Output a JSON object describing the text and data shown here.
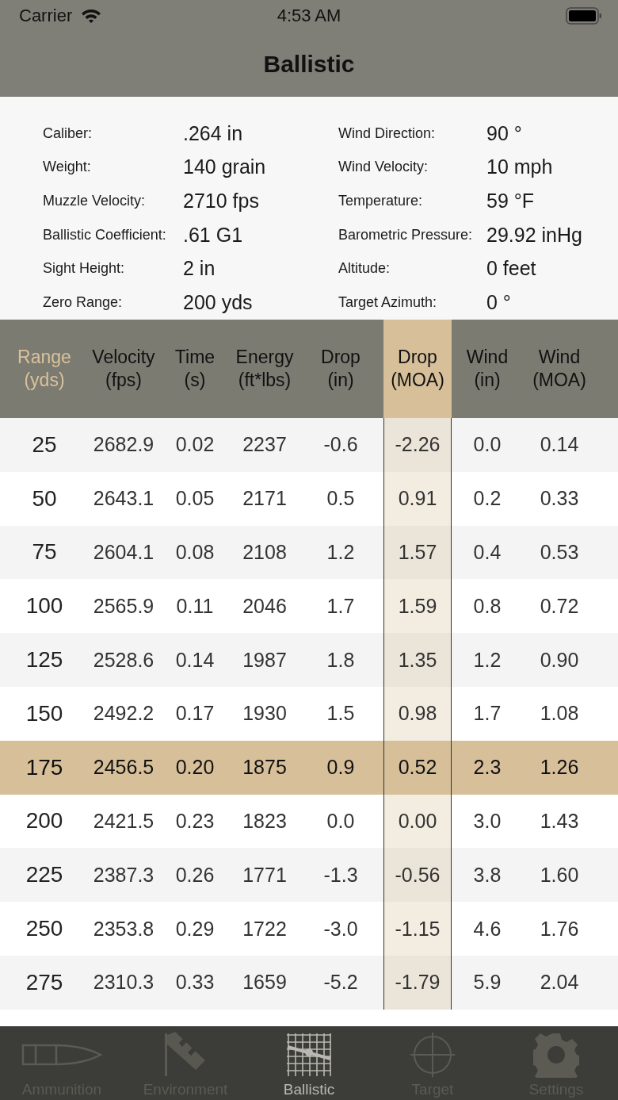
{
  "status_bar": {
    "carrier": "Carrier",
    "time": "4:53 AM"
  },
  "nav": {
    "title": "Ballistic"
  },
  "parameters": [
    {
      "label": "Caliber:",
      "value": ".264 in"
    },
    {
      "label": "Wind Direction:",
      "value": "90 °"
    },
    {
      "label": "Weight:",
      "value": "140 grain"
    },
    {
      "label": "Wind Velocity:",
      "value": "10 mph"
    },
    {
      "label": "Muzzle Velocity:",
      "value": "2710 fps"
    },
    {
      "label": "Temperature:",
      "value": "59 °F"
    },
    {
      "label": "Ballistic Coefficient:",
      "value": ".61 G1"
    },
    {
      "label": "Barometric Pressure:",
      "value": "29.92 inHg"
    },
    {
      "label": "Sight Height:",
      "value": "2 in"
    },
    {
      "label": "Altitude:",
      "value": "0 feet"
    },
    {
      "label": "Zero Range:",
      "value": "200 yds"
    },
    {
      "label": "Target Azimuth:",
      "value": "0 °"
    }
  ],
  "table": {
    "columns": [
      {
        "title": "Range",
        "unit": "(yds)",
        "active": true,
        "highlighted": false
      },
      {
        "title": "Velocity",
        "unit": "(fps)",
        "active": false,
        "highlighted": false
      },
      {
        "title": "Time",
        "unit": "(s)",
        "active": false,
        "highlighted": false
      },
      {
        "title": "Energy",
        "unit": "(ft*lbs)",
        "active": false,
        "highlighted": false
      },
      {
        "title": "Drop",
        "unit": "(in)",
        "active": false,
        "highlighted": false
      },
      {
        "title": "Drop",
        "unit": "(MOA)",
        "active": false,
        "highlighted": true
      },
      {
        "title": "Wind",
        "unit": "(in)",
        "active": false,
        "highlighted": false
      },
      {
        "title": "Wind",
        "unit": "(MOA)",
        "active": false,
        "highlighted": false
      }
    ],
    "rows": [
      {
        "selected": false,
        "cells": [
          "25",
          "2682.9",
          "0.02",
          "2237",
          "-0.6",
          "-2.26",
          "0.0",
          "0.14"
        ]
      },
      {
        "selected": false,
        "cells": [
          "50",
          "2643.1",
          "0.05",
          "2171",
          "0.5",
          "0.91",
          "0.2",
          "0.33"
        ]
      },
      {
        "selected": false,
        "cells": [
          "75",
          "2604.1",
          "0.08",
          "2108",
          "1.2",
          "1.57",
          "0.4",
          "0.53"
        ]
      },
      {
        "selected": false,
        "cells": [
          "100",
          "2565.9",
          "0.11",
          "2046",
          "1.7",
          "1.59",
          "0.8",
          "0.72"
        ]
      },
      {
        "selected": false,
        "cells": [
          "125",
          "2528.6",
          "0.14",
          "1987",
          "1.8",
          "1.35",
          "1.2",
          "0.90"
        ]
      },
      {
        "selected": false,
        "cells": [
          "150",
          "2492.2",
          "0.17",
          "1930",
          "1.5",
          "0.98",
          "1.7",
          "1.08"
        ]
      },
      {
        "selected": true,
        "cells": [
          "175",
          "2456.5",
          "0.20",
          "1875",
          "0.9",
          "0.52",
          "2.3",
          "1.26"
        ]
      },
      {
        "selected": false,
        "cells": [
          "200",
          "2421.5",
          "0.23",
          "1823",
          "0.0",
          "0.00",
          "3.0",
          "1.43"
        ]
      },
      {
        "selected": false,
        "cells": [
          "225",
          "2387.3",
          "0.26",
          "1771",
          "-1.3",
          "-0.56",
          "3.8",
          "1.60"
        ]
      },
      {
        "selected": false,
        "cells": [
          "250",
          "2353.8",
          "0.29",
          "1722",
          "-3.0",
          "-1.15",
          "4.6",
          "1.76"
        ]
      },
      {
        "selected": false,
        "cells": [
          "275",
          "2310.3",
          "0.33",
          "1659",
          "-5.2",
          "-1.79",
          "5.9",
          "2.04"
        ]
      }
    ]
  },
  "tab_bar": [
    {
      "kind": "bullet",
      "label": "Ammunition",
      "selected": false
    },
    {
      "kind": "windsock",
      "label": "Environment",
      "selected": false
    },
    {
      "kind": "grid",
      "label": "Ballistic",
      "selected": true
    },
    {
      "kind": "crosshair",
      "label": "Target",
      "selected": false
    },
    {
      "kind": "gear",
      "label": "Settings",
      "selected": false
    }
  ]
}
